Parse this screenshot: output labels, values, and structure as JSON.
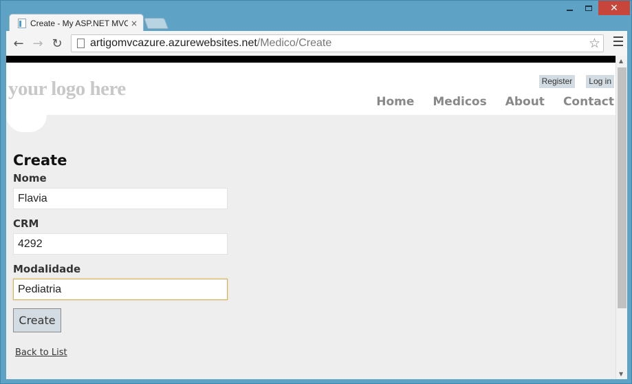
{
  "browser": {
    "tab_title": "Create - My ASP.NET MVC",
    "tab_close": "×",
    "url_host": "artigomvcazure.azurewebsites.net",
    "url_path": "/Medico/Create",
    "back_glyph": "←",
    "forward_glyph": "→",
    "reload_glyph": "↻",
    "star_glyph": "☆",
    "close_glyph": "✕"
  },
  "site": {
    "logo": "your logo here",
    "login": {
      "register": "Register",
      "login": "Log in"
    },
    "nav": {
      "home": "Home",
      "medicos": "Medicos",
      "about": "About",
      "contact": "Contact"
    }
  },
  "form": {
    "title": "Create",
    "nome": {
      "label": "Nome",
      "value": "Flavia"
    },
    "crm": {
      "label": "CRM",
      "value": "4292"
    },
    "modalidade": {
      "label": "Modalidade",
      "value": "Pediatria"
    },
    "submit": "Create",
    "back": "Back to List"
  },
  "colors": {
    "accent_close": "#c7463b",
    "page_bg": "#efeeef",
    "focus_border": "#d4b05a"
  }
}
